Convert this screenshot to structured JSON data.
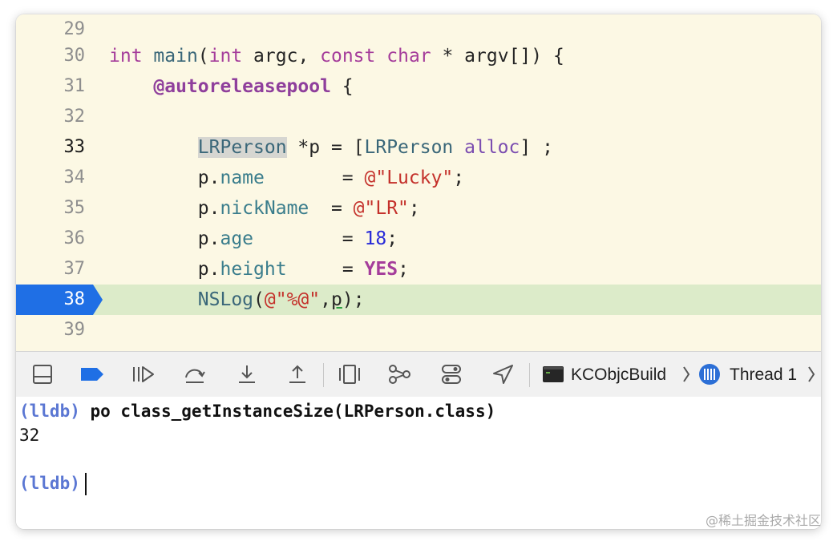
{
  "editor": {
    "lines": {
      "l29": {
        "num": "29"
      },
      "l30": {
        "num": "30",
        "kw_int": "int",
        "main": "main",
        "paren_open": "(",
        "kw_int2": "int",
        "argc": " argc, ",
        "kw_const": "const",
        "sp1": " ",
        "kw_char": "char",
        "rest": " * argv[]) {"
      },
      "l31": {
        "num": "31",
        "indent": "    ",
        "directive": "@autoreleasepool",
        "rest": " {"
      },
      "l32": {
        "num": "32"
      },
      "l33": {
        "num": "33",
        "indent": "        ",
        "type": "LRPerson",
        "mid": " *p = [",
        "type2": "LRPerson",
        "sp": " ",
        "method": "alloc",
        "rest": "] ;"
      },
      "l34": {
        "num": "34",
        "indent": "        ",
        "obj": "p.",
        "prop": "name",
        "eq": "       = ",
        "str": "@\"Lucky\"",
        "semi": ";"
      },
      "l35": {
        "num": "35",
        "indent": "        ",
        "obj": "p.",
        "prop": "nickName",
        "eq": "  = ",
        "str": "@\"LR\"",
        "semi": ";"
      },
      "l36": {
        "num": "36",
        "indent": "        ",
        "obj": "p.",
        "prop": "age",
        "eq": "        = ",
        "numval": "18",
        "semi": ";"
      },
      "l37": {
        "num": "37",
        "indent": "        ",
        "obj": "p.",
        "prop": "height",
        "eq": "     = ",
        "kwval": "YES",
        "semi": ";"
      },
      "l38": {
        "num": "38",
        "indent": "        ",
        "func": "NSLog",
        "paren": "(",
        "str": "@\"%@\"",
        "comma": ",",
        "arg": "p",
        "rest": ");"
      },
      "l39": {
        "num": "39"
      }
    }
  },
  "toolbar": {
    "target": "KCObjcBuild",
    "thread": "Thread 1",
    "colors": {
      "breakpoint": "#1f6fe5"
    }
  },
  "console": {
    "prompt": "(lldb)",
    "command": " po class_getInstanceSize(LRPerson.class)",
    "output": "32",
    "prompt2": "(lldb)"
  },
  "watermark": "@稀土掘金技术社区"
}
